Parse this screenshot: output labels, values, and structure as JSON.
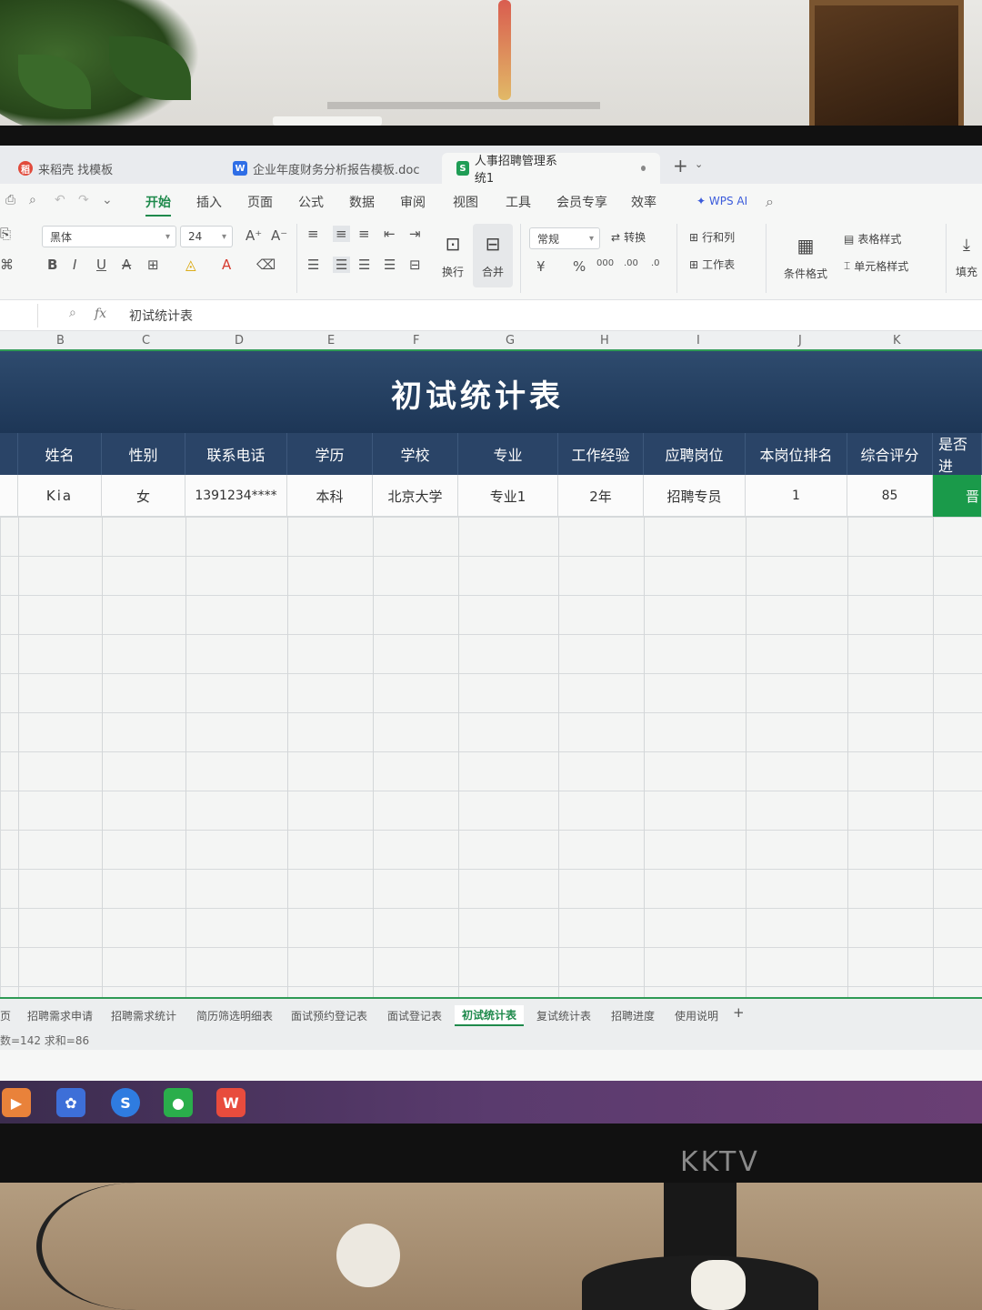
{
  "tabs": [
    {
      "label": "来稻壳 找模板",
      "badge": "稻"
    },
    {
      "label": "企业年度财务分析报告模板.doc",
      "badge": "W"
    },
    {
      "label": "人事招聘管理系统1",
      "badge": "S"
    }
  ],
  "menu": [
    "开始",
    "插入",
    "页面",
    "公式",
    "数据",
    "审阅",
    "视图",
    "工具",
    "会员专享",
    "效率"
  ],
  "wps_ai": "WPS AI",
  "ribbon": {
    "font_name": "黑体",
    "font_size": "24",
    "number_format": "常规",
    "wrap": "换行",
    "merge": "合并",
    "convert": "转换",
    "row_col": "行和列",
    "worksheet": "工作表",
    "cond_format": "条件格式",
    "table_style": "表格样式",
    "cell_style": "单元格样式",
    "fill": "填充"
  },
  "formula_bar": {
    "fx": "fx",
    "content": "初试统计表"
  },
  "column_letters": [
    "B",
    "C",
    "D",
    "E",
    "F",
    "G",
    "H",
    "I",
    "J",
    "K"
  ],
  "sheet": {
    "title": "初试统计表",
    "headers": [
      "姓名",
      "性别",
      "联系电话",
      "学历",
      "学校",
      "专业",
      "工作经验",
      "应聘岗位",
      "本岗位排名",
      "综合评分",
      "是否进"
    ],
    "row1": [
      "Kia",
      "女",
      "1391234****",
      "本科",
      "北京大学",
      "专业1",
      "2年",
      "招聘专员",
      "1",
      "85",
      "晋"
    ]
  },
  "sheet_tabs": [
    "页",
    "招聘需求申请",
    "招聘需求统计",
    "简历筛选明细表",
    "面试预约登记表",
    "面试登记表",
    "初试统计表",
    "复试统计表",
    "招聘进度",
    "使用说明",
    "+"
  ],
  "status": "数=142  求和=86",
  "monitor_brand": "KKTV"
}
